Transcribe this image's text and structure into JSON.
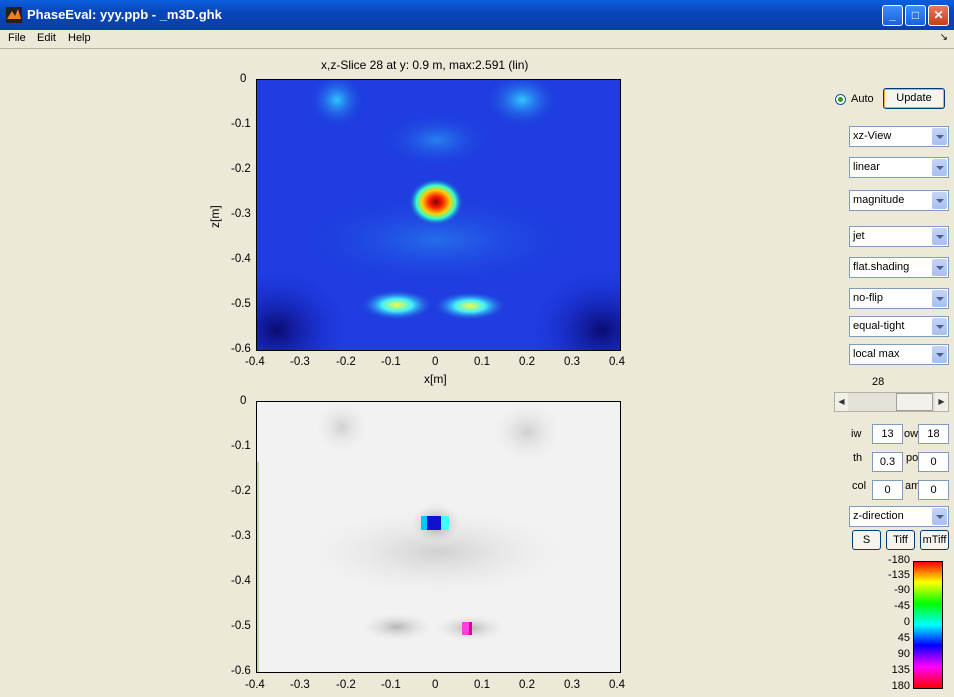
{
  "window": {
    "title": "PhaseEval: yyy.ppb - _m3D.ghk",
    "dock_glyph": "↘"
  },
  "menu": [
    "File",
    "Edit",
    "Help"
  ],
  "top_plot": {
    "title": "x,z-Slice 28 at y: 0.9 m, max:2.591 (lin)",
    "xlabel": "x[m]",
    "ylabel": "z[m]",
    "xticks": [
      "-0.4",
      "-0.3",
      "-0.2",
      "-0.1",
      "0",
      "0.1",
      "0.2",
      "0.3",
      "0.4"
    ],
    "yticks": [
      "0",
      "-0.1",
      "-0.2",
      "-0.3",
      "-0.4",
      "-0.5",
      "-0.6"
    ]
  },
  "bottom_plot": {
    "xticks": [
      "-0.4",
      "-0.3",
      "-0.2",
      "-0.1",
      "0",
      "0.1",
      "0.2",
      "0.3",
      "0.4"
    ],
    "yticks": [
      "0",
      "-0.1",
      "-0.2",
      "-0.3",
      "-0.4",
      "-0.5",
      "-0.6"
    ]
  },
  "controls": {
    "auto_label": "Auto",
    "auto_checked": true,
    "update_label": "Update",
    "dropdowns": [
      "xz-View",
      "linear",
      "magnitude",
      "jet",
      "flat.shading",
      "no-flip",
      "equal-tight",
      "local max"
    ],
    "slice_value": "28",
    "fields": {
      "iw_label": "iw",
      "iw_value": "13",
      "ow_label": "ow",
      "ow_value": "18",
      "th_label": "th",
      "th_value": "0.3",
      "po_label": "po",
      "po_value": "0",
      "col_label": "col",
      "col_value": "0",
      "am_label": "am",
      "am_value": "0"
    },
    "direction": "z-direction",
    "s_label": "S",
    "tiff_label": "Tiff",
    "mtiff_label": "mTiff"
  },
  "colorbar": {
    "ticks": [
      "-180",
      "-135",
      "-90",
      "-45",
      "0",
      "45",
      "90",
      "135",
      "180"
    ]
  },
  "colors": {
    "titlebar": "#0846b8",
    "jet_bg": "#1a2bd8",
    "face": "#ece9d8"
  }
}
